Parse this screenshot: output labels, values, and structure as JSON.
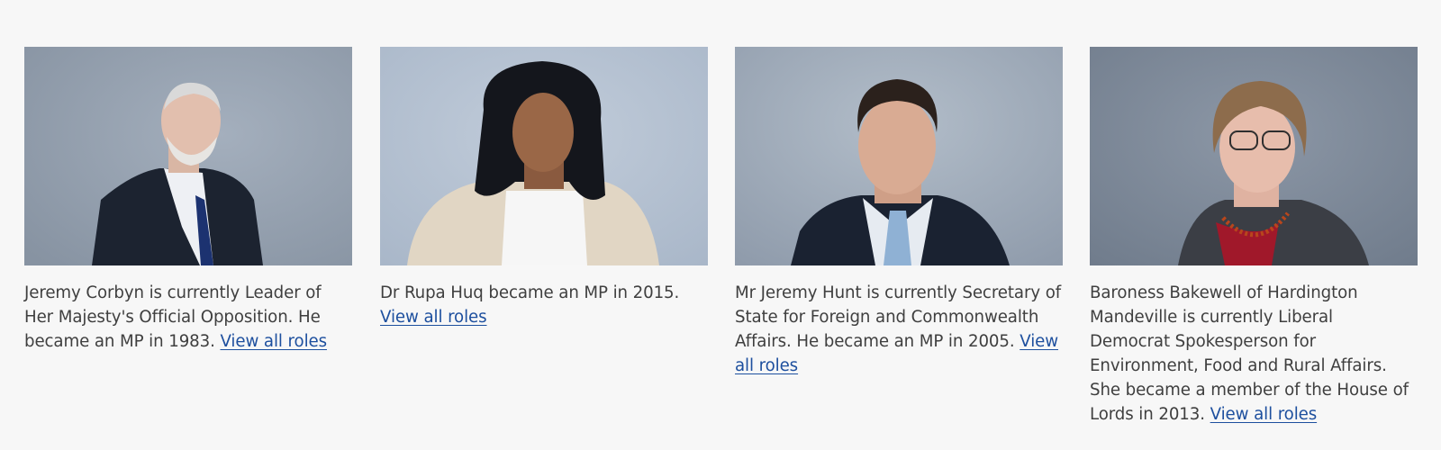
{
  "colors": {
    "page_background": "#f7f7f7",
    "body_text": "#3f3f3f",
    "link": "#1d4f9e"
  },
  "people": [
    {
      "portrait_icon": "portrait-photo-icon",
      "bio": "Jeremy Corbyn is currently Leader of Her Majesty's Official Opposition. He became an MP in 1983.",
      "link_label": "View all roles"
    },
    {
      "portrait_icon": "portrait-photo-icon",
      "bio": "Dr Rupa Huq became an MP in 2015.",
      "link_label": "View all roles"
    },
    {
      "portrait_icon": "portrait-photo-icon",
      "bio": "Mr Jeremy Hunt is currently Secretary of State for Foreign and Commonwealth Affairs. He became an MP in 2005.",
      "link_label": "View all roles"
    },
    {
      "portrait_icon": "portrait-photo-icon",
      "bio": "Baroness Bakewell of Hardington Mandeville is currently Liberal Democrat Spokesperson for Environment, Food and Rural Affairs. She became a member of the House of Lords in 2013.",
      "link_label": "View all roles"
    }
  ]
}
